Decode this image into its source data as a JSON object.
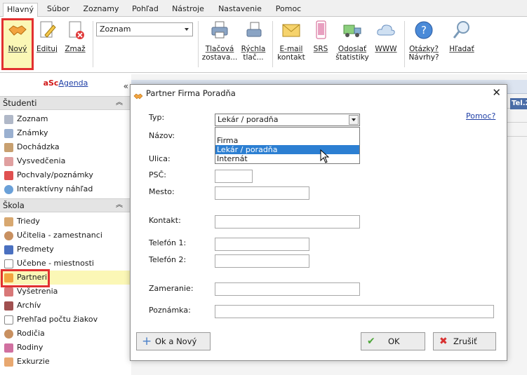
{
  "tabs": [
    "Hlavný",
    "Súbor",
    "Zoznamy",
    "Pohľad",
    "Nástroje",
    "Nastavenie",
    "Pomoc"
  ],
  "ribbon": {
    "novy": "Nový",
    "edituj": "Edituj",
    "zmaz": "Zmaž",
    "dropdown_value": "Zoznam",
    "tlacova_1": "Tlačová",
    "tlacova_2": "zostava...",
    "rychla_1": "Rýchla",
    "rychla_2": "tlač...",
    "email_1": "E-mail",
    "email_2": "kontakt",
    "srs": "SRS",
    "odoslat_1": "Odoslať",
    "odoslat_2": "štatistiky",
    "www": "WWW",
    "otazky_1": "Otázky?",
    "otazky_2": "Návrhy?",
    "hladat": "Hľadať"
  },
  "sidebar": {
    "agenda_prefix": "aSc",
    "agenda_suffix": "Agenda",
    "collapse": "«",
    "section1": "Študenti",
    "section1_items": [
      "Zoznam",
      "Známky",
      "Dochádzka",
      "Vysvedčenia",
      "Pochvaly/poznámky",
      "Interaktívny náhľad"
    ],
    "section2": "Škola",
    "section2_items": [
      "Triedy",
      "Učitelia - zamestnanci",
      "Predmety",
      "Učebne - miestnosti",
      "Partneri",
      "Vyšetrenia",
      "Archív",
      "Prehľad počtu žiakov",
      "Rodičia",
      "Rodiny",
      "Exkurzie"
    ]
  },
  "background": {
    "tel_header": "Tel.2"
  },
  "dialog": {
    "title": "Partner Firma Poradňa",
    "help": "Pomoc?",
    "typ_label": "Typ:",
    "typ_value": "Lekár / poradňa",
    "typ_options": [
      "Firma",
      "Lekár / poradňa",
      "Internát"
    ],
    "nazov": "Názov:",
    "ulica": "Ulica:",
    "psc": "PSČ:",
    "mesto": "Mesto:",
    "kontakt": "Kontakt:",
    "telefon1": "Telefón 1:",
    "telefon2": "Telefón 2:",
    "zameranie": "Zameranie:",
    "poznamka": "Poznámka:",
    "ok_novy": "Ok a Nový",
    "ok": "OK",
    "zrusit": "Zrušiť"
  }
}
